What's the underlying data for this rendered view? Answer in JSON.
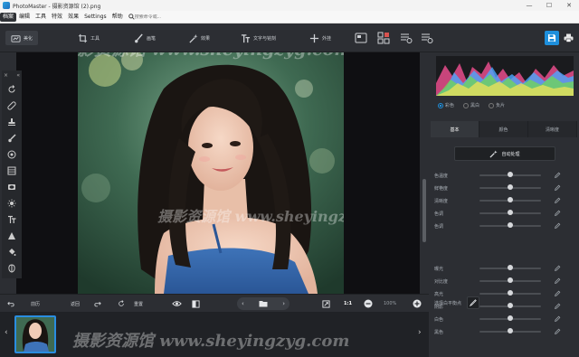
{
  "window": {
    "title": "PhotoMaster - 摄影资源馆 (2).png",
    "controls": [
      "—",
      "☐",
      "✕"
    ]
  },
  "menu": {
    "items": [
      "档案",
      "编辑",
      "工具",
      "特效",
      "效果",
      "Settings",
      "帮助"
    ],
    "active_index": 0,
    "search_placeholder": "搜索命令或..."
  },
  "toolbar": {
    "tools": [
      {
        "label": "美化",
        "icon": "enhance-icon"
      },
      {
        "label": "工具",
        "icon": "crop-icon"
      },
      {
        "label": "画笔",
        "icon": "brush-icon"
      },
      {
        "label": "效果",
        "icon": "magic-wand-icon"
      },
      {
        "label": "文字与铭刻",
        "icon": "text-icon"
      },
      {
        "label": "外挂",
        "icon": "plus-icon"
      }
    ],
    "active_index": 0
  },
  "left_tools": [
    "rotate",
    "heal",
    "stamp",
    "brush",
    "radial",
    "gradient",
    "vignette",
    "light",
    "text",
    "fill",
    "bucket",
    "mask"
  ],
  "bottom_bar": {
    "undo_label": "前历",
    "redo_label": "返回",
    "reset_label": "重置",
    "zoom_ratio": "1:1",
    "zoom_percent": "100%"
  },
  "right_panel": {
    "color_modes": [
      "彩色",
      "黑白",
      "负片"
    ],
    "selected_mode": 0,
    "tabs": [
      "基本",
      "颜色",
      "清晰度"
    ],
    "active_tab": 0,
    "auto_button": "自动处理",
    "sliders_top": [
      {
        "label": "色温度",
        "value": 0.5
      },
      {
        "label": "鲜艳度",
        "value": 0.5
      },
      {
        "label": "清晰度",
        "value": 0.5
      },
      {
        "label": "色调",
        "value": 0.5
      },
      {
        "label": "色调",
        "value": 0.5
      }
    ],
    "white_balance_label": "选择白平衡点",
    "sliders_bottom": [
      {
        "label": "曝光",
        "value": 0.5
      },
      {
        "label": "对比度",
        "value": 0.5
      },
      {
        "label": "高光",
        "value": 0.5
      },
      {
        "label": "阴影",
        "value": 0.5
      },
      {
        "label": "白色",
        "value": 0.5
      },
      {
        "label": "黑色",
        "value": 0.5
      }
    ]
  },
  "watermark": {
    "text_1": "摄影资源馆 www.sheyingzyg.com",
    "text_2": "摄影资源馆 www.sheyingzyg.com"
  },
  "colors": {
    "accent": "#1e8fdc",
    "panel": "#2c2e33",
    "dark": "#0f0f12"
  }
}
